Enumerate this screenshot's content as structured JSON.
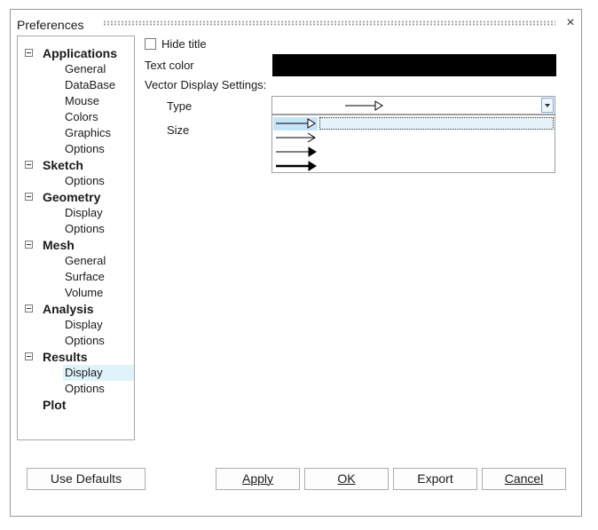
{
  "window": {
    "title": "Preferences",
    "close_glyph": "×"
  },
  "tree": {
    "items": [
      {
        "label": "Applications",
        "level": 0
      },
      {
        "label": "General",
        "level": 1
      },
      {
        "label": "DataBase",
        "level": 1
      },
      {
        "label": "Mouse",
        "level": 1
      },
      {
        "label": "Colors",
        "level": 1
      },
      {
        "label": "Graphics",
        "level": 1
      },
      {
        "label": "Options",
        "level": 1
      },
      {
        "label": "Sketch",
        "level": 0
      },
      {
        "label": "Options",
        "level": 1
      },
      {
        "label": "Geometry",
        "level": 0
      },
      {
        "label": "Display",
        "level": 1
      },
      {
        "label": "Options",
        "level": 1
      },
      {
        "label": "Mesh",
        "level": 0
      },
      {
        "label": "General",
        "level": 1
      },
      {
        "label": "Surface",
        "level": 1
      },
      {
        "label": "Volume",
        "level": 1
      },
      {
        "label": "Analysis",
        "level": 0
      },
      {
        "label": "Display",
        "level": 1
      },
      {
        "label": "Options",
        "level": 1
      },
      {
        "label": "Results",
        "level": 0
      },
      {
        "label": "Display",
        "level": 1,
        "selected": true
      },
      {
        "label": "Options",
        "level": 1
      },
      {
        "label": "Plot",
        "level": 0
      }
    ]
  },
  "settings": {
    "hide_title_label": "Hide title",
    "hide_title_checked": false,
    "text_color_label": "Text color",
    "text_color_value": "#000000",
    "vector_section_label": "Vector Display Settings:",
    "type_label": "Type",
    "size_label": "Size",
    "type_selected": "thin-line-hollow-head-arrow",
    "type_options": [
      "thin-line-hollow-head-arrow",
      "thin-line-open-head-arrow",
      "thin-line-solid-head-arrow",
      "thick-line-solid-head-arrow"
    ]
  },
  "buttons": {
    "use_defaults": "Use Defaults",
    "apply": "Apply",
    "ok": "OK",
    "export": "Export",
    "cancel": "Cancel"
  },
  "colors": {
    "accent_selection": "#c5e4f7",
    "tree_selection": "#e0f3fb"
  }
}
